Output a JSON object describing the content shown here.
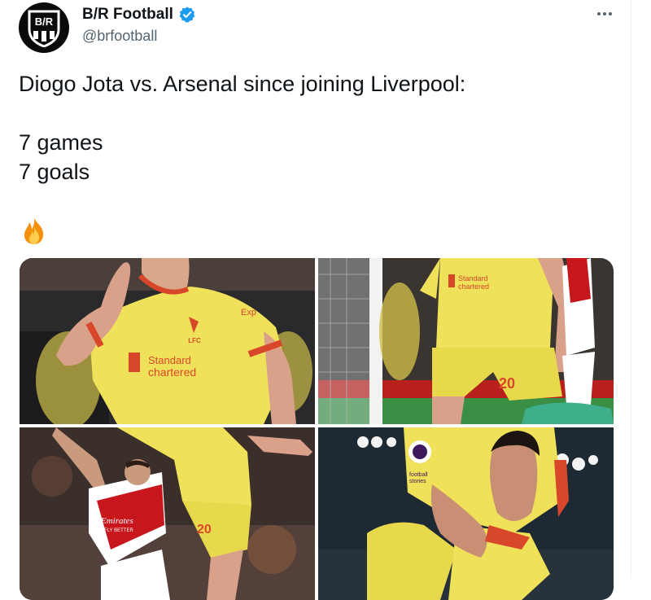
{
  "author": {
    "display_name": "B/R Football",
    "handle": "@brfootball",
    "avatar_logo_text": "B/R",
    "verified": true
  },
  "tweet": {
    "line1": "Diogo Jota vs. Arsenal since joining Liverpool:",
    "line2": "7 games",
    "line3": "7 goals",
    "emoji": "fire-emoji"
  },
  "photos": {
    "photo1": {
      "sponsor_line1": "Standard",
      "sponsor_line2": "chartered",
      "crest_text": "LFC",
      "sleeve_text": "Exp"
    },
    "photo2": {
      "sponsor_line1": "Standard",
      "sponsor_line2": "chartered",
      "shorts_number": "20"
    },
    "photo3": {
      "opponent_sponsor": "Emirates",
      "opponent_sponsor2": "FLY BETTER",
      "shorts_number": "20"
    },
    "photo4": {
      "sleeve_text1": "football",
      "sleeve_text2": "stories"
    }
  },
  "colors": {
    "jersey_yellow": "#efe15a",
    "jersey_red_trim": "#d9472b",
    "verified_blue": "#1d9bf0",
    "arsenal_red": "#c8161d"
  }
}
